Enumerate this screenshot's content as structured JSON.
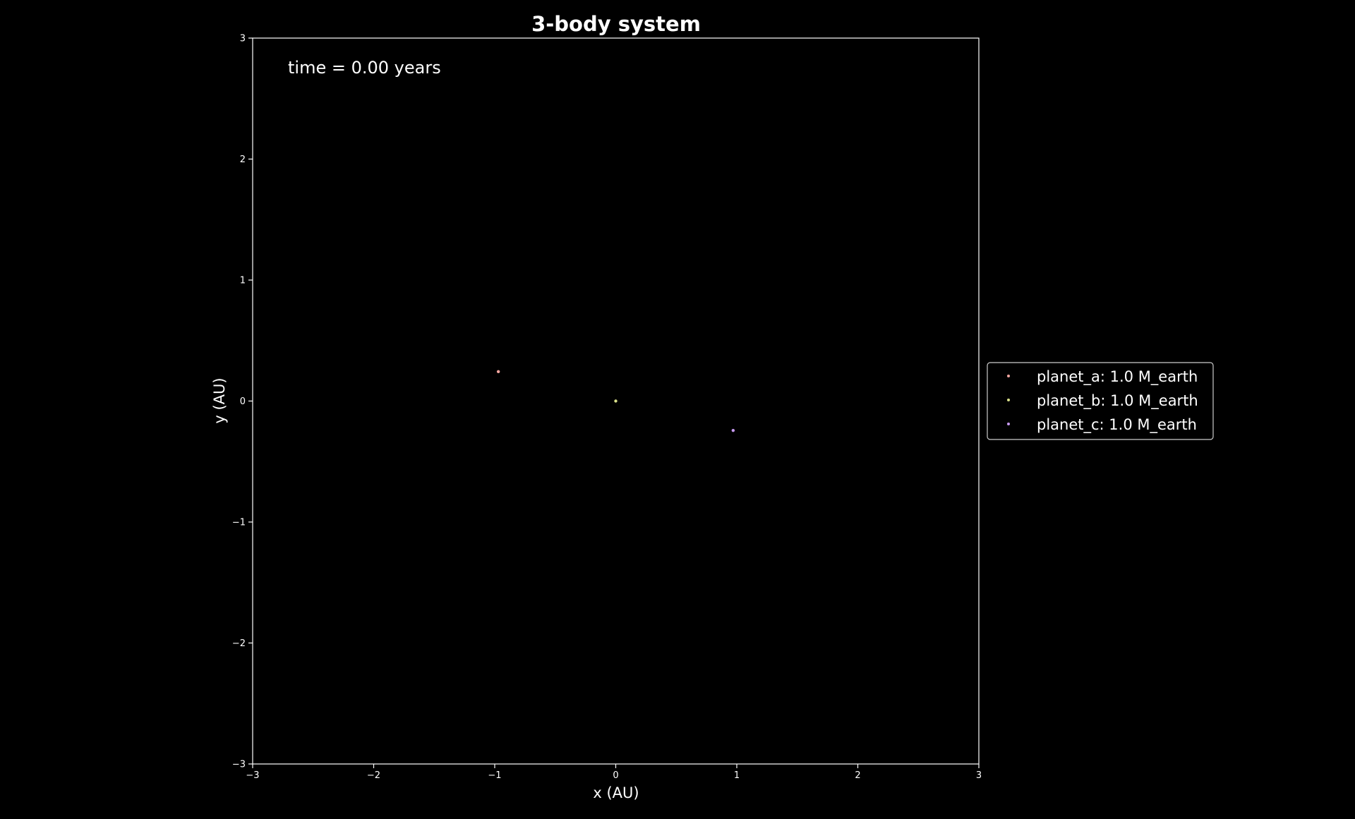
{
  "chart_data": {
    "type": "scatter",
    "title": "3-body system",
    "xlabel": "x (AU)",
    "ylabel": "y (AU)",
    "xlim": [
      -3,
      3
    ],
    "ylim": [
      -3,
      3
    ],
    "xticks": [
      -3,
      -2,
      -1,
      0,
      1,
      2,
      3
    ],
    "yticks": [
      -3,
      -2,
      -1,
      0,
      1,
      2,
      3
    ],
    "xtick_labels": [
      "−3",
      "−2",
      "−1",
      "0",
      "1",
      "2",
      "3"
    ],
    "ytick_labels": [
      "−3",
      "−2",
      "−1",
      "0",
      "1",
      "2",
      "3"
    ],
    "grid": false,
    "background": "#000000",
    "annotation": "time = 0.00 years",
    "legend_position": "center-right outside",
    "series": [
      {
        "name": "planet_a: 1.0 M_earth",
        "color": "#f4a6a0",
        "x": [
          -0.97
        ],
        "y": [
          0.243
        ]
      },
      {
        "name": "planet_b: 1.0 M_earth",
        "color": "#d9e08a",
        "x": [
          0.0
        ],
        "y": [
          0.0
        ]
      },
      {
        "name": "planet_c: 1.0 M_earth",
        "color": "#c79af0",
        "x": [
          0.97
        ],
        "y": [
          -0.243
        ]
      }
    ]
  }
}
